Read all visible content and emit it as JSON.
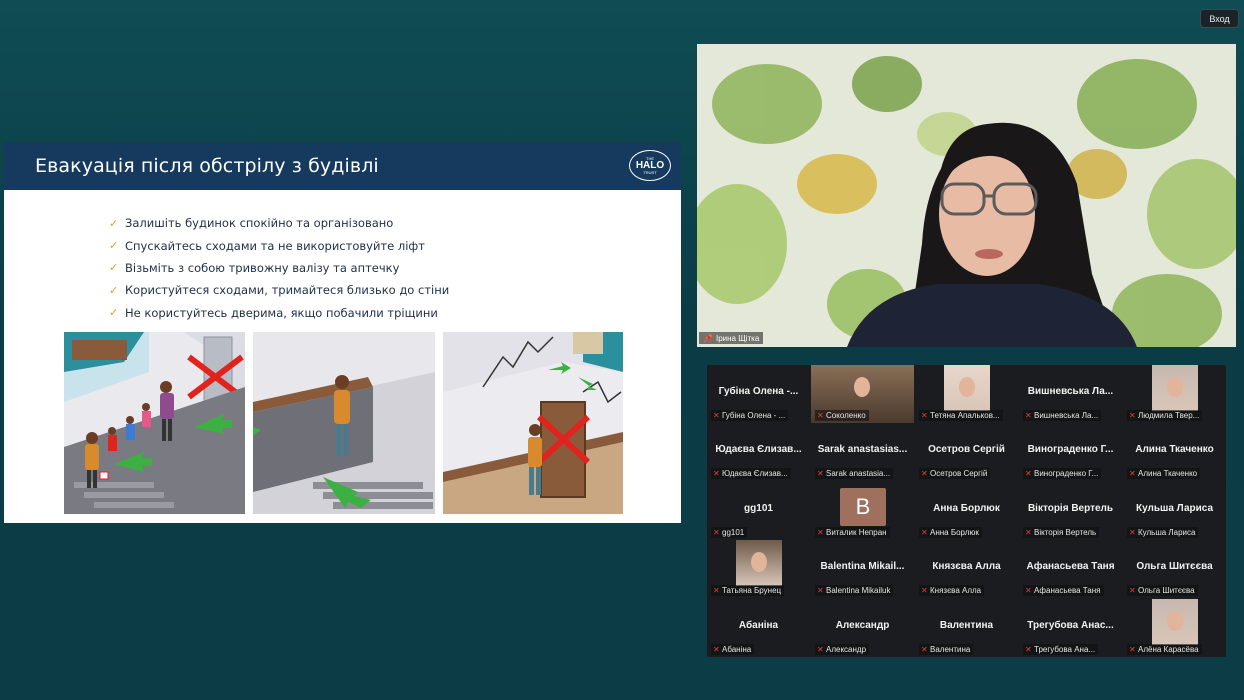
{
  "top_button": {
    "label": "Вход"
  },
  "slide": {
    "title": "Евакуація після обстрілу з будівлі",
    "logo": {
      "the": "THE",
      "halo": "HALO",
      "trust": "TRUST"
    },
    "bullets": [
      "Залишіть будинок спокійно та організовано",
      "Спускайтесь сходами та не використовуйте ліфт",
      "Візьміть з собою тривожну валізу та аптечку",
      "Користуйтеся сходами, тримайтеся близько до стіни",
      "Не користуйтесь дверима, якщо побачили тріщини"
    ],
    "bullet_icon": "check-icon"
  },
  "speaker": {
    "name": "Ірина Щітка",
    "icon": "pin-icon"
  },
  "gallery": {
    "tiles": [
      {
        "big": "Губіна Олена -...",
        "foot": "Губіна Олена - ...",
        "video": false
      },
      {
        "big": "",
        "foot": "Соколенко",
        "video": true
      },
      {
        "big": "",
        "foot": "Тетяна Апальков...",
        "video": true
      },
      {
        "big": "Вишневська Ла...",
        "foot": "Вишневська Ла...",
        "video": false
      },
      {
        "big": "",
        "foot": "Людмила Твер...",
        "video": true
      },
      {
        "big": "Юдаєва Єлизав...",
        "foot": "Юдаєва Єлизав...",
        "video": false
      },
      {
        "big": "Sarak anastasias...",
        "foot": "Sarak anastasia...",
        "video": false
      },
      {
        "big": "Осетров Сергій",
        "foot": "Осетров Сергій",
        "video": false
      },
      {
        "big": "Винограденко Г...",
        "foot": "Винограденко Г...",
        "video": false
      },
      {
        "big": "Алина Ткаченко",
        "foot": "Алина Ткаченко",
        "video": false
      },
      {
        "big": "gg101",
        "foot": "gg101",
        "video": false
      },
      {
        "big": "B",
        "foot": "Виталик Непран",
        "video": false
      },
      {
        "big": "Анна Борлюк",
        "foot": "Анна Борлюк",
        "video": false
      },
      {
        "big": "Вікторія Вертель",
        "foot": "Вікторія Вертель",
        "video": false
      },
      {
        "big": "Кульша Лариса",
        "foot": "Кульша Лариса",
        "video": false
      },
      {
        "big": "",
        "foot": "Татьяна Брунец",
        "video": true
      },
      {
        "big": "Balentina Mikail...",
        "foot": "Balentina Mikailuk",
        "video": false
      },
      {
        "big": "Князєва Алла",
        "foot": "Князєва Алла",
        "video": false
      },
      {
        "big": "Афанасьева Таня",
        "foot": "Афанасьева Таня",
        "video": false
      },
      {
        "big": "Ольга Шитєєва",
        "foot": "Ольга Шитєєва",
        "video": false
      },
      {
        "big": "Абаніна",
        "foot": "Абаніна",
        "video": false
      },
      {
        "big": "Александр",
        "foot": "Александр",
        "video": false
      },
      {
        "big": "Валентина",
        "foot": "Валентина",
        "video": false
      },
      {
        "big": "Трегубова Анас...",
        "foot": "Трегубова Ана...",
        "video": false
      },
      {
        "big": "",
        "foot": "Алёна Карасёва",
        "video": true
      }
    ],
    "muted_icon": "mic-muted-icon",
    "colors": {
      "muted": "#e0413c",
      "avatar_b": "#a0705f"
    }
  }
}
